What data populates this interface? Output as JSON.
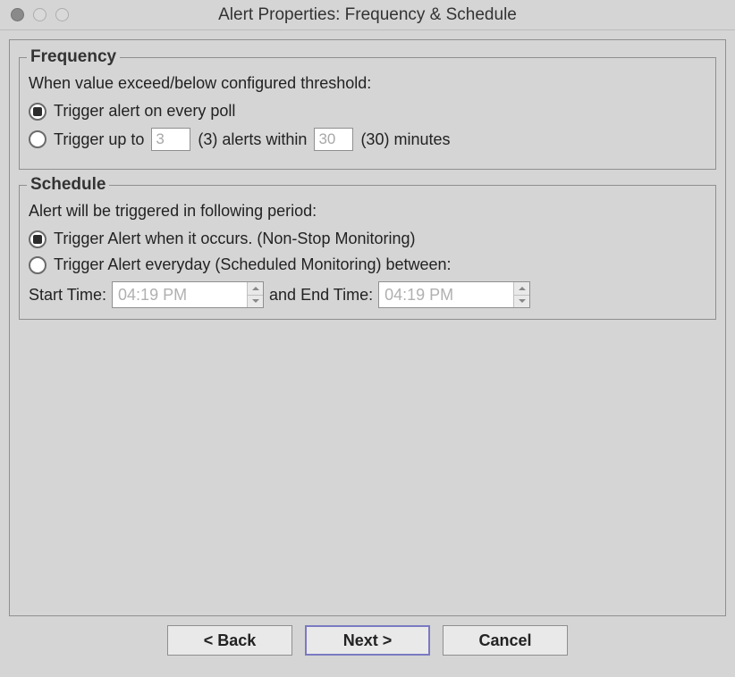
{
  "window": {
    "title": "Alert Properties: Frequency & Schedule"
  },
  "frequency": {
    "legend": "Frequency",
    "description": "When value exceed/below configured threshold:",
    "option1_label": "Trigger alert on every poll",
    "option2_prefix": "Trigger up to",
    "option2_mid": "(3) alerts within",
    "option2_suffix": "(30) minutes",
    "alerts_count_value": "3",
    "within_minutes_value": "30"
  },
  "schedule": {
    "legend": "Schedule",
    "description": "Alert will be triggered in following period:",
    "option1_label": "Trigger Alert when it occurs. (Non-Stop Monitoring)",
    "option2_label": "Trigger Alert everyday (Scheduled Monitoring) between:",
    "start_label": "Start Time:",
    "end_label": "and End Time:",
    "start_time_value": "04:19 PM",
    "end_time_value": "04:19 PM"
  },
  "buttons": {
    "back": "< Back",
    "next": "Next >",
    "cancel": "Cancel"
  }
}
